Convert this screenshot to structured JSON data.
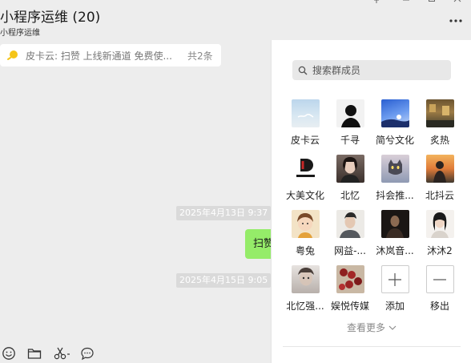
{
  "header": {
    "title": "小程序运维 (20)",
    "subtitle": "小程序运维",
    "more_label": "..."
  },
  "notice": {
    "text": "皮卡云: 扫赞 上线新通道  免费使...",
    "count": "共2条"
  },
  "messages": {
    "time1": "2025年4月13日 9:37",
    "bubble_text": "扫赞",
    "time2": "2025年4月15日 9:05"
  },
  "member_panel": {
    "search_placeholder": "搜索群成员",
    "members": [
      {
        "name": "皮卡云",
        "icon": "sky-photo-avatar"
      },
      {
        "name": "千寻",
        "icon": "silhouette-avatar"
      },
      {
        "name": "简兮文化",
        "icon": "night-sky-avatar"
      },
      {
        "name": "炙热",
        "icon": "street-scene-avatar"
      },
      {
        "name": "大美文化",
        "icon": "brand-logo-avatar"
      },
      {
        "name": "北忆",
        "icon": "portrait-avatar"
      },
      {
        "name": "抖会推...",
        "icon": "cat-avatar"
      },
      {
        "name": "北抖云",
        "icon": "sunset-avatar"
      },
      {
        "name": "粤兔",
        "icon": "cartoon-girl-avatar"
      },
      {
        "name": "网益-...",
        "icon": "man-portrait-avatar"
      },
      {
        "name": "沐岚音...",
        "icon": "dark-portrait-avatar"
      },
      {
        "name": "沐沐2",
        "icon": "woman-portrait-avatar"
      },
      {
        "name": "北忆强...",
        "icon": "blurred-face-avatar"
      },
      {
        "name": "娱悦传媒",
        "icon": "beads-avatar"
      }
    ],
    "add_label": "添加",
    "remove_label": "移出",
    "view_more_label": "查看更多"
  },
  "colors": {
    "background": "#ededed",
    "bubble": "#95ec69",
    "panel": "#ffffff",
    "notice_icon": "#f5c518"
  }
}
